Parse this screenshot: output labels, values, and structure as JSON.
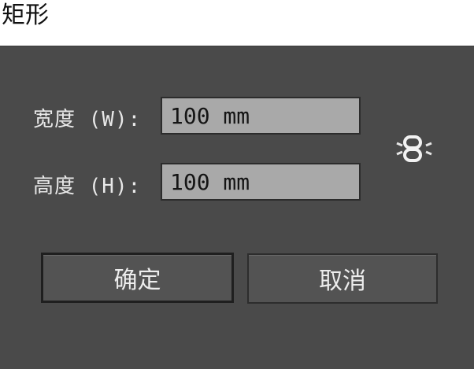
{
  "window": {
    "title": "矩形"
  },
  "form": {
    "width_label": "宽度 (W):",
    "width_value": "100 mm",
    "height_label": "高度 (H):",
    "height_value": "100 mm",
    "constrain_icon": "link-icon"
  },
  "buttons": {
    "ok_label": "确定",
    "cancel_label": "取消"
  },
  "colors": {
    "dialog_bg": "#4a4a4a",
    "input_bg": "#a9a9a9",
    "text_light": "#e8e8e8"
  }
}
